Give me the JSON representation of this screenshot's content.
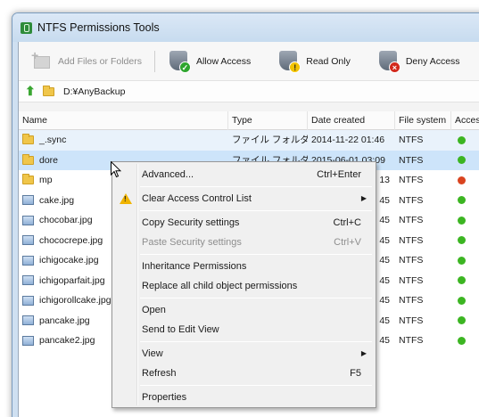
{
  "window": {
    "title": "NTFS Permissions Tools"
  },
  "toolbar": {
    "add_label": "Add Files or Folders",
    "allow_label": "Allow Access",
    "read_label": "Read Only",
    "deny_label": "Deny Access"
  },
  "address": {
    "path": "D:¥AnyBackup"
  },
  "columns": {
    "name": "Name",
    "type": "Type",
    "date": "Date created",
    "fs": "File system",
    "access": "Acces"
  },
  "rows": [
    {
      "name": "_.sync",
      "kind": "folder",
      "type": "ファイル フォルダー",
      "date": "2014-11-22 01:46",
      "fs": "NTFS",
      "access": "green"
    },
    {
      "name": "dore",
      "kind": "folder",
      "type": "ファイル フォルダー",
      "date": "2015-06-01 03:09",
      "fs": "NTFS",
      "access": "green"
    },
    {
      "name": "mp",
      "kind": "folder",
      "type": "",
      "date": "13",
      "fs": "NTFS",
      "access": "red"
    },
    {
      "name": "cake.jpg",
      "kind": "image",
      "type": "",
      "date": "45",
      "fs": "NTFS",
      "access": "green"
    },
    {
      "name": "chocobar.jpg",
      "kind": "image",
      "type": "",
      "date": "45",
      "fs": "NTFS",
      "access": "green"
    },
    {
      "name": "chococrepe.jpg",
      "kind": "image",
      "type": "",
      "date": "45",
      "fs": "NTFS",
      "access": "green"
    },
    {
      "name": "ichigocake.jpg",
      "kind": "image",
      "type": "",
      "date": "45",
      "fs": "NTFS",
      "access": "green"
    },
    {
      "name": "ichigoparfait.jpg",
      "kind": "image",
      "type": "",
      "date": "45",
      "fs": "NTFS",
      "access": "green"
    },
    {
      "name": "ichigorollcake.jpg",
      "kind": "image",
      "type": "",
      "date": "45",
      "fs": "NTFS",
      "access": "green"
    },
    {
      "name": "pancake.jpg",
      "kind": "image",
      "type": "",
      "date": "45",
      "fs": "NTFS",
      "access": "green"
    },
    {
      "name": "pancake2.jpg",
      "kind": "image",
      "type": "",
      "date": "45",
      "fs": "NTFS",
      "access": "green"
    }
  ],
  "context_menu": {
    "advanced": "Advanced...",
    "advanced_sc": "Ctrl+Enter",
    "clear_acl": "Clear Access Control List",
    "copy_sec": "Copy Security settings",
    "copy_sc": "Ctrl+C",
    "paste_sec": "Paste Security settings",
    "paste_sc": "Ctrl+V",
    "inherit": "Inheritance Permissions",
    "replace_child": "Replace all child object permissions",
    "open": "Open",
    "send_edit": "Send to Edit View",
    "view": "View",
    "refresh": "Refresh",
    "refresh_sc": "F5",
    "properties": "Properties"
  },
  "colors": {
    "green": "#3cb522",
    "red": "#d9441f"
  }
}
